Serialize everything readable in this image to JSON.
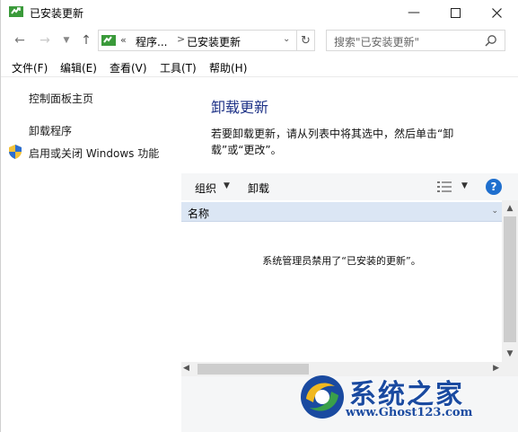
{
  "window": {
    "title": "已安装更新"
  },
  "address": {
    "segment1": "程序...",
    "segment2": "已安装更新",
    "separator": ">",
    "chevron": "«"
  },
  "search": {
    "placeholder": "搜索\"已安装更新\""
  },
  "menu": [
    "文件(F)",
    "编辑(E)",
    "查看(V)",
    "工具(T)",
    "帮助(H)"
  ],
  "left_pane": {
    "home": "控制面板主页",
    "uninstall_program": "卸载程序",
    "windows_features": "启用或关闭 Windows 功能"
  },
  "main": {
    "heading": "卸载更新",
    "description": "若要卸载更新，请从列表中将其选中，然后单击“卸载”或“更改”。"
  },
  "toolbar": {
    "organize": "组织",
    "uninstall": "卸载",
    "help": "?"
  },
  "list": {
    "column_name": "名称",
    "empty_message": "系统管理员禁用了“已安装的更新”。"
  },
  "watermark": {
    "brand": "系统之家",
    "url": "www.Ghost123.com"
  },
  "colors": {
    "heading": "#1e3287",
    "header_bg": "#dbe6f4",
    "toolbar_bg": "#f5f6f7",
    "help": "#1f6fce"
  }
}
